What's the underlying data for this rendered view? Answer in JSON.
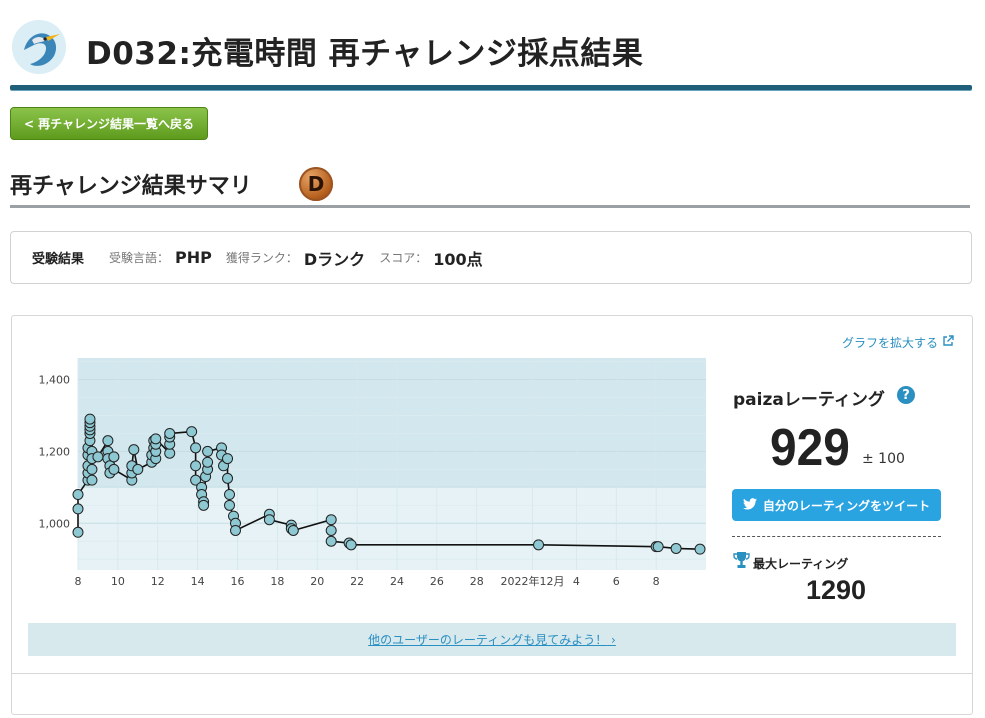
{
  "header": {
    "title": "D032:充電時間 再チャレンジ採点結果",
    "logo": "paiza-bird-logo"
  },
  "nav": {
    "back_label": "< 再チャレンジ結果一覧へ戻る"
  },
  "summary": {
    "heading": "再チャレンジ結果サマリ",
    "rank_badge": "D"
  },
  "result": {
    "label": "受験結果",
    "language_label": "受験言語：",
    "language_value": "PHP",
    "rank_label": "獲得ランク：",
    "rank_value": "Dランク",
    "score_label": "スコア：",
    "score_value": "100点"
  },
  "rating": {
    "expand_label": "グラフを拡大する",
    "title": "paizaレーティング",
    "value": "929",
    "margin": "± 100",
    "tweet_label": "自分のレーティングをツイート",
    "max_label": "最大レーティング",
    "max_value": "1290",
    "others_link": "他のユーザーのレーティングも見てみよう！"
  },
  "colors": {
    "accent": "#2a8fc1",
    "chart_upper_band": "#d3e8ee",
    "chart_lower_band": "#e6f2f5",
    "point_fill": "#8ec8d2",
    "back_button": "#6aa820"
  },
  "chart_data": {
    "type": "line",
    "x_tick_labels": [
      "8",
      "10",
      "12",
      "14",
      "16",
      "18",
      "20",
      "22",
      "24",
      "26",
      "28",
      "2022年12月",
      "4",
      "6",
      "8"
    ],
    "y_tick_labels": [
      "1,000",
      "1,200",
      "1,400"
    ],
    "ylim": [
      870,
      1460
    ],
    "band_split": 1100,
    "grid": true,
    "series": [
      {
        "x": [
          0,
          0,
          0,
          0.5,
          0.5,
          0.5,
          0.5,
          0.5,
          0.6,
          0.6,
          0.6,
          0.6,
          0.6,
          0.6,
          0.7,
          0.7,
          0.7,
          0.7,
          1.0,
          1.5,
          1.5,
          1.5,
          1.6,
          1.6,
          1.8,
          1.8,
          2.7,
          2.7,
          2.7,
          2.8,
          3.0,
          3.7,
          3.7,
          3.8,
          3.8,
          3.9,
          3.9,
          3.9,
          3.9,
          4.6,
          4.6,
          4.6,
          4.6,
          5.7,
          5.9,
          5.9,
          5.9,
          6.2,
          6.2,
          6.3,
          6.3,
          6.4,
          6.5,
          6.5,
          6.5,
          7.2,
          7.2,
          7.3,
          7.5,
          7.5,
          7.6,
          7.6,
          7.8,
          7.9,
          7.9,
          9.6,
          9.6,
          10.7,
          10.7,
          10.8,
          12.7,
          12.7,
          12.7,
          13.6,
          13.7,
          23.1,
          29.0,
          29.1,
          30.0,
          31.2
        ],
        "y": [
          975,
          1040,
          1080,
          1120,
          1140,
          1160,
          1190,
          1210,
          1230,
          1250,
          1260,
          1270,
          1280,
          1290,
          1150,
          1120,
          1200,
          1180,
          1185,
          1230,
          1200,
          1180,
          1160,
          1140,
          1185,
          1150,
          1120,
          1140,
          1160,
          1205,
          1150,
          1170,
          1190,
          1210,
          1230,
          1180,
          1200,
          1220,
          1235,
          1195,
          1220,
          1240,
          1250,
          1255,
          1210,
          1160,
          1120,
          1100,
          1080,
          1060,
          1050,
          1130,
          1150,
          1170,
          1200,
          1210,
          1190,
          1160,
          1180,
          1125,
          1080,
          1050,
          1020,
          1000,
          980,
          1025,
          1010,
          995,
          985,
          980,
          1010,
          980,
          950,
          945,
          940,
          940,
          935,
          935,
          930,
          928
        ]
      }
    ]
  }
}
